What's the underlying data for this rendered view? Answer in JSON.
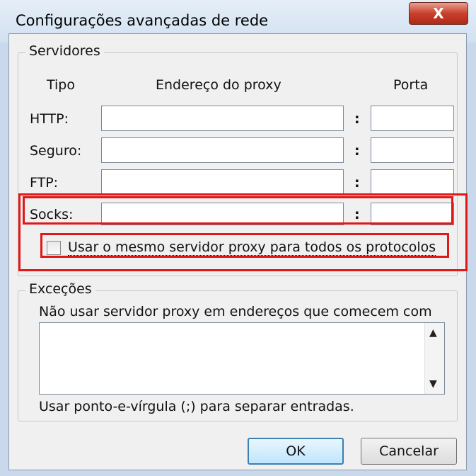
{
  "window": {
    "title": "Configurações avançadas de rede",
    "close_glyph": "X"
  },
  "servers": {
    "legend": "Servidores",
    "headers": {
      "type": "Tipo",
      "address": "Endereço do proxy",
      "port": "Porta"
    },
    "rows": [
      {
        "label": "HTTP:",
        "address": "",
        "port": ""
      },
      {
        "label": "Seguro:",
        "address": "",
        "port": ""
      },
      {
        "label": "FTP:",
        "address": "",
        "port": ""
      },
      {
        "label": "Socks:",
        "address": "",
        "port": ""
      }
    ],
    "colon": ":",
    "same_proxy_checkbox": {
      "label": "Usar o mesmo servidor proxy para todos os protocolos",
      "checked": false
    }
  },
  "exceptions": {
    "legend": "Exceções",
    "description": "Não usar servidor proxy em endereços que comecem com",
    "value": "",
    "hint": "Usar ponto-e-vírgula (;) para separar entradas."
  },
  "buttons": {
    "ok": "OK",
    "cancel": "Cancelar"
  },
  "colors": {
    "highlight": "#e01818",
    "default_button": "#3c7fb1"
  }
}
